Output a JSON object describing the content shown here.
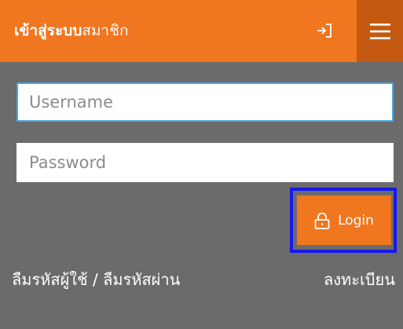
{
  "header": {
    "title_strong": "เข้าสู่ระบบ",
    "title_light": "สมาชิก",
    "login_icon": "sign-in-icon",
    "menu_icon": "hamburger-menu-icon",
    "bg_color": "#f0761f",
    "menu_bg_color": "#c45a12"
  },
  "form": {
    "username": {
      "value": "",
      "placeholder": "Username"
    },
    "password": {
      "value": "",
      "placeholder": "Password"
    },
    "login_label": "Login",
    "login_icon": "lock-icon"
  },
  "links": {
    "forgot": "ลืมรหัสผู้ใช้ / ลืมรหัสผ่าน",
    "register": "ลงทะเบียน"
  },
  "colors": {
    "background": "#6b6b6b",
    "accent": "#f0761f",
    "focus_border": "#4aa7de",
    "highlight_box": "#1818ee"
  }
}
